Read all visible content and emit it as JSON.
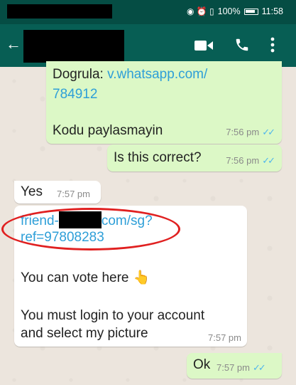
{
  "status_bar": {
    "indicators": "◉ ⏰ ▯",
    "battery_text": "100%",
    "time": "11:58"
  },
  "app_bar": {
    "back_icon": "arrow-left",
    "actions": [
      "video-call-icon",
      "phone-icon",
      "more-vert-icon"
    ]
  },
  "messages": [
    {
      "direction": "outgoing",
      "prefix": "Dogrula: ",
      "link_line1": "v.whatsapp.com/",
      "link_line2": "784912",
      "text_line3": "Kodu paylasmayin",
      "time": "7:56 pm",
      "ticks": "✓✓"
    },
    {
      "direction": "outgoing",
      "text": "Is this correct?",
      "time": "7:56 pm",
      "ticks": "✓✓"
    },
    {
      "direction": "incoming",
      "text": "Yes",
      "time": "7:57 pm"
    },
    {
      "direction": "incoming",
      "link_part1": "friend-",
      "link_part2": "com/sg?",
      "link_line2": "ref=97808283",
      "line_vote": "You can vote here",
      "vote_emoji": "👆",
      "line_login1": "You must login to your account",
      "line_login2": "and select my picture",
      "time": "7:57 pm"
    },
    {
      "direction": "outgoing",
      "text": "Ok",
      "time": "7:57 pm",
      "ticks": "✓✓"
    }
  ],
  "colors": {
    "header": "#075e54",
    "status_bar": "#054d44",
    "outgoing_bubble": "#dcf8c6",
    "incoming_bubble": "#ffffff",
    "link": "#2e9fd8",
    "read_ticks": "#4fb6ec",
    "annotation_circle": "#e02020"
  }
}
